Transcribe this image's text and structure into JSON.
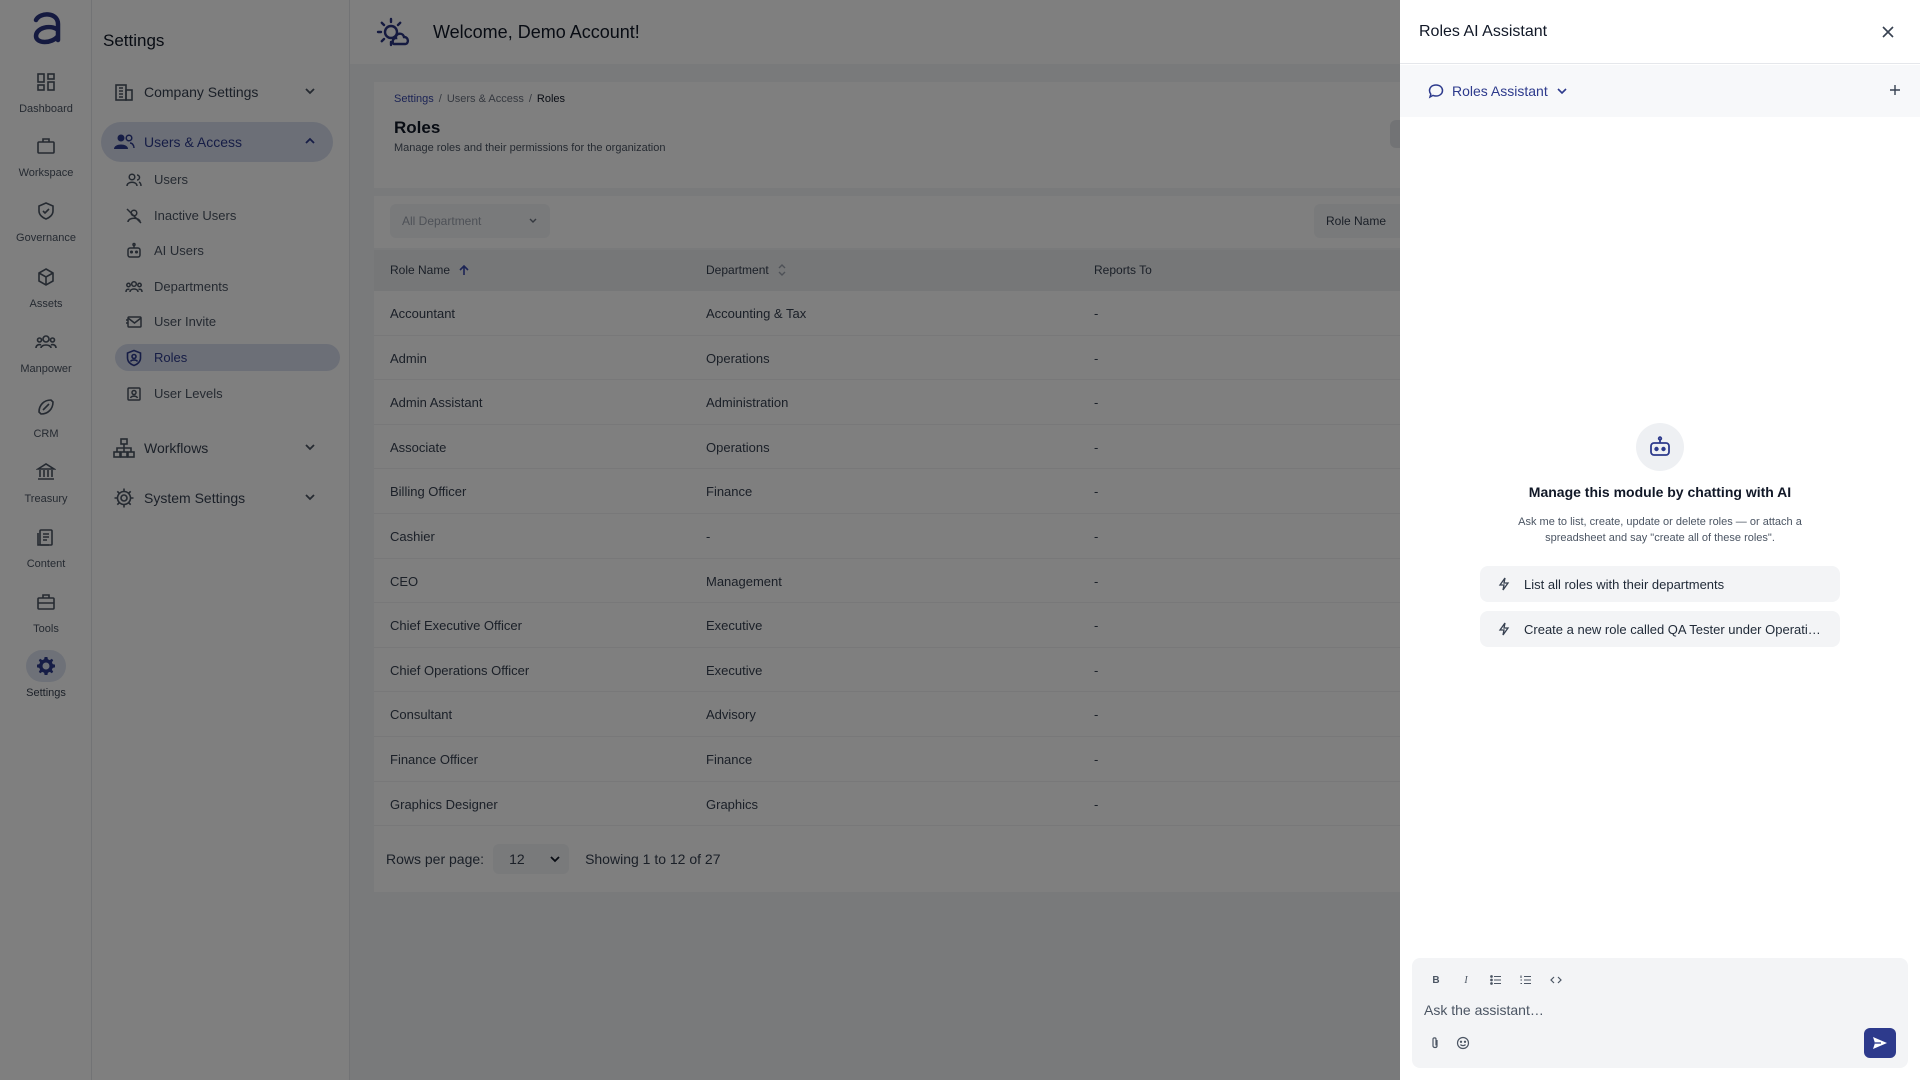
{
  "rail": {
    "items": [
      {
        "label": "Dashboard",
        "icon": "dashboard-icon"
      },
      {
        "label": "Workspace",
        "icon": "briefcase-icon"
      },
      {
        "label": "Governance",
        "icon": "shield-check-icon"
      },
      {
        "label": "Assets",
        "icon": "cube-icon"
      },
      {
        "label": "Manpower",
        "icon": "people-icon"
      },
      {
        "label": "CRM",
        "icon": "handshake-icon"
      },
      {
        "label": "Treasury",
        "icon": "bank-icon"
      },
      {
        "label": "Content",
        "icon": "document-icon"
      },
      {
        "label": "Tools",
        "icon": "toolbox-icon"
      },
      {
        "label": "Settings",
        "icon": "gear-icon"
      }
    ],
    "active": "Settings"
  },
  "sidebar": {
    "title": "Settings",
    "groups": [
      {
        "label": "Company Settings",
        "icon": "building-icon",
        "expanded": false
      },
      {
        "label": "Users & Access",
        "icon": "users-icon",
        "expanded": true
      },
      {
        "label": "Workflows",
        "icon": "hierarchy-icon",
        "expanded": false
      },
      {
        "label": "System Settings",
        "icon": "gear-icon",
        "expanded": false
      }
    ],
    "sub_items": [
      {
        "label": "Users",
        "icon": "user-icon"
      },
      {
        "label": "Inactive Users",
        "icon": "user-off-icon"
      },
      {
        "label": "AI Users",
        "icon": "robot-icon"
      },
      {
        "label": "Departments",
        "icon": "group-icon"
      },
      {
        "label": "User Invite",
        "icon": "mail-icon"
      },
      {
        "label": "Roles",
        "icon": "badge-icon"
      },
      {
        "label": "User Levels",
        "icon": "level-icon"
      }
    ],
    "active_sub": "Roles"
  },
  "header": {
    "title": "Welcome, Demo Account!"
  },
  "page": {
    "breadcrumb": [
      "Settings",
      "Users & Access",
      "Roles"
    ],
    "separator": "/",
    "title": "Roles",
    "description": "Manage roles and their permissions for the organization"
  },
  "filters": {
    "department_placeholder": "All Department",
    "role_name_label": "Role Name"
  },
  "table": {
    "columns": [
      "Role Name",
      "Department",
      "Reports To"
    ],
    "rows": [
      [
        "Accountant",
        "Accounting & Tax",
        "-"
      ],
      [
        "Admin",
        "Operations",
        "-"
      ],
      [
        "Admin Assistant",
        "Administration",
        "-"
      ],
      [
        "Associate",
        "Operations",
        "-"
      ],
      [
        "Billing Officer",
        "Finance",
        "-"
      ],
      [
        "Cashier",
        "-",
        "-"
      ],
      [
        "CEO",
        "Management",
        "-"
      ],
      [
        "Chief Executive Officer",
        "Executive",
        "-"
      ],
      [
        "Chief Operations Officer",
        "Executive",
        "-"
      ],
      [
        "Consultant",
        "Advisory",
        "-"
      ],
      [
        "Finance Officer",
        "Finance",
        "-"
      ],
      [
        "Graphics Designer",
        "Graphics",
        "-"
      ]
    ]
  },
  "pagination": {
    "rows_per_page_label": "Rows per page:",
    "rows_per_page": "12",
    "showing": "Showing 1 to 12 of 27"
  },
  "assistant": {
    "title": "Roles AI Assistant",
    "selector": "Roles Assistant",
    "empty_title": "Manage this module by chatting with AI",
    "empty_desc": "Ask me to list, create, update or delete roles — or attach a spreadsheet and say \"create all of these roles\".",
    "suggestions": [
      "List all roles with their departments",
      "Create a new role called QA Tester under Operations"
    ],
    "input_placeholder": "Ask the assistant…",
    "format_buttons": [
      "B",
      "I"
    ]
  },
  "colors": {
    "accent": "#2d3a8c",
    "active_bg": "#d8deee",
    "overlay": "rgba(0,0,0,0.5)"
  }
}
